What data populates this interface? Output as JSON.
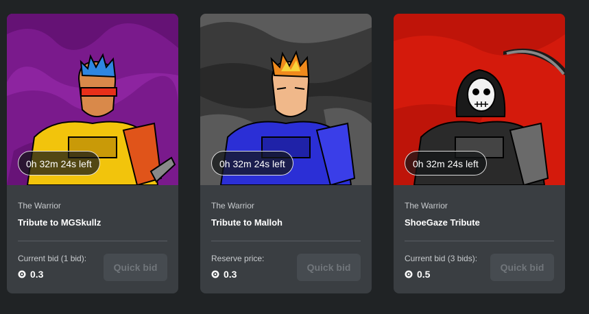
{
  "cards": [
    {
      "timer": "0h 32m 24s left",
      "collection": "The Warrior",
      "title": "Tribute to MGSkullz",
      "bid_label": "Current bid (1 bid):",
      "bid_value": "0.3",
      "quick_bid": "Quick bid",
      "colors": {
        "background": "#7a1a8c",
        "armor": "#f2c40c",
        "hair": "#2f86e0"
      }
    },
    {
      "timer": "0h 32m 24s left",
      "collection": "The Warrior",
      "title": "Tribute to Malloh",
      "bid_label": "Reserve price:",
      "bid_value": "0.3",
      "quick_bid": "Quick bid",
      "colors": {
        "background": "#3a3a3a",
        "armor": "#2b2fd6",
        "hair": "#f08a1c"
      }
    },
    {
      "timer": "0h 32m 24s left",
      "collection": "The Warrior",
      "title": "ShoeGaze Tribute",
      "bid_label": "Current bid (3 bids):",
      "bid_value": "0.5",
      "quick_bid": "Quick bid",
      "colors": {
        "background": "#d41a0c",
        "armor": "#2a2a2a",
        "hair": "#1a1a1a"
      }
    }
  ]
}
